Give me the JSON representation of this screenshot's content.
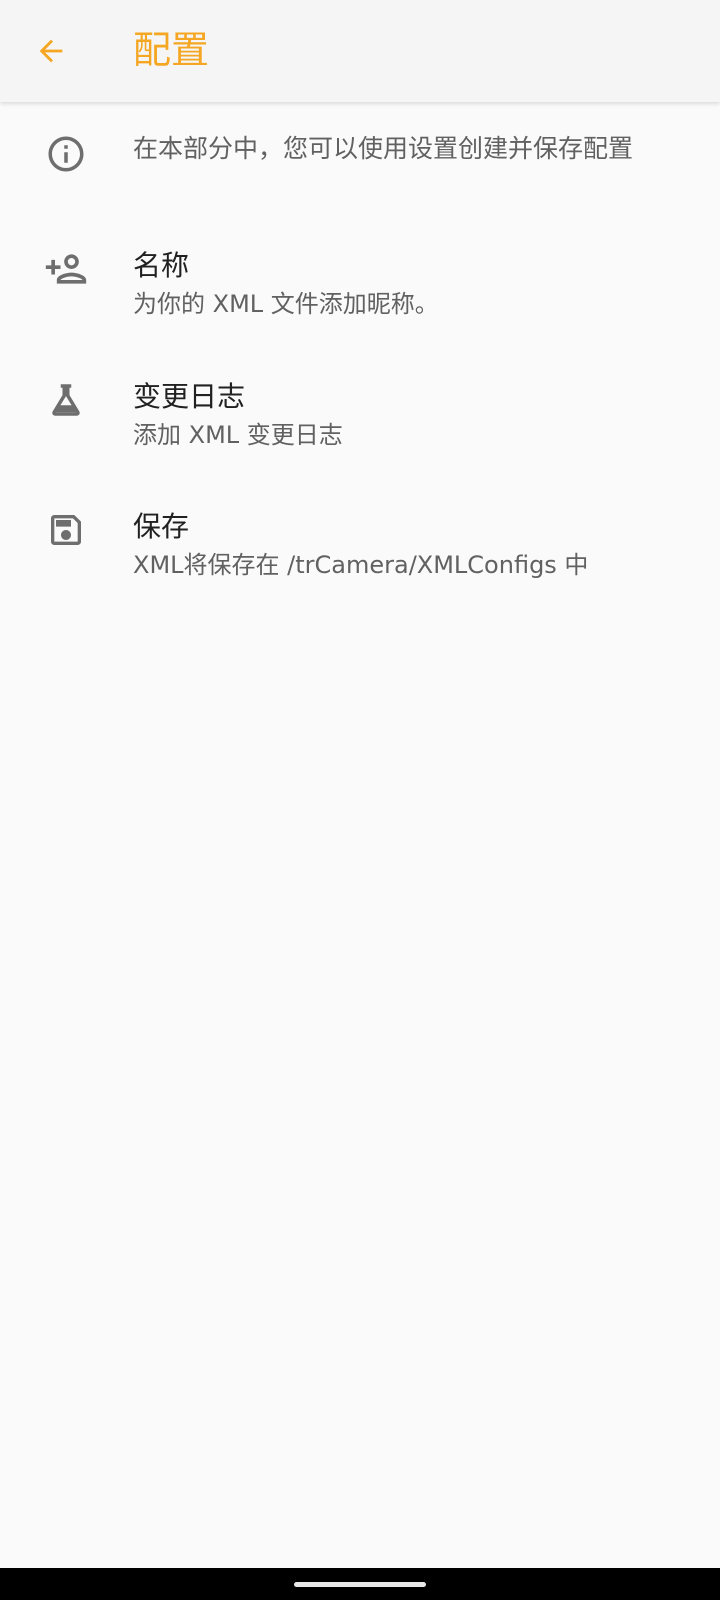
{
  "colors": {
    "accent": "#f5a623",
    "icon": "#6e6e6e",
    "background": "#fafafa"
  },
  "header": {
    "title": "配置",
    "back_icon": "arrow-back-icon"
  },
  "info": {
    "icon": "info-icon",
    "text": "在本部分中，您可以使用设置创建并保存配置"
  },
  "items": [
    {
      "icon": "person-add-icon",
      "title": "名称",
      "subtitle": "为你的 XML 文件添加昵称。"
    },
    {
      "icon": "flask-icon",
      "title": "变更日志",
      "subtitle": "添加 XML 变更日志"
    },
    {
      "icon": "save-icon",
      "title": "保存",
      "subtitle": "XML将保存在 /trCamera/XMLConfigs 中"
    }
  ]
}
